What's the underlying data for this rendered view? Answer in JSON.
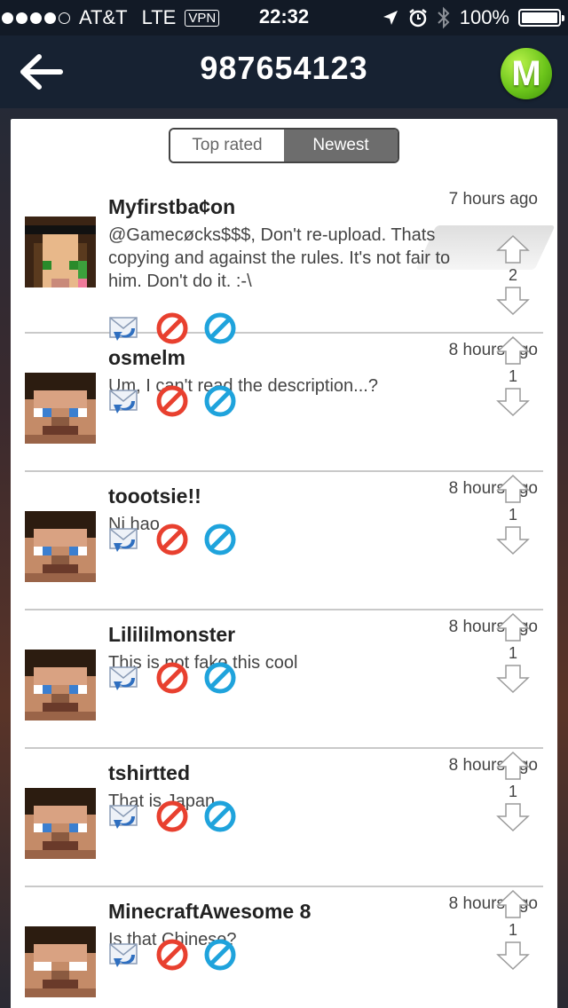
{
  "status_bar": {
    "carrier": "AT&T",
    "network": "LTE",
    "vpn": "VPN",
    "time": "22:32",
    "battery": "100%"
  },
  "nav": {
    "title": "987654123",
    "logo_letter": "M"
  },
  "tabs": [
    {
      "label": "Top rated",
      "active": false
    },
    {
      "label": "Newest",
      "active": true
    }
  ],
  "comments": [
    {
      "user": "Myfirstba¢on",
      "time": "7 hours ago",
      "text": "@Gamecøcks$$$, Don't re-upload. Thats copying and against the rules. It's not fair to him. Don't do it. :-\\",
      "votes": "2",
      "avatar": "girl"
    },
    {
      "user": "osmelm",
      "time": "8 hours ago",
      "text": "Um, I can't read the description...?",
      "votes": "1",
      "avatar": "steve"
    },
    {
      "user": "toootsie!!",
      "time": "8 hours ago",
      "text": "Ni hao",
      "votes": "1",
      "avatar": "steve"
    },
    {
      "user": "Lilililmonster",
      "time": "8 hours ago",
      "text": "This is not fake this cool",
      "votes": "1",
      "avatar": "steve"
    },
    {
      "user": "tshirtted",
      "time": "8 hours ago",
      "text": "That is Japan",
      "votes": "1",
      "avatar": "steve"
    },
    {
      "user": "MinecraftAwesome 8",
      "time": "8 hours ago",
      "text": "Is that Chinese?",
      "votes": "1",
      "avatar": "herobrine"
    }
  ],
  "colors": {
    "status_bar_bg": "#121a26",
    "nav_bg": "#172232",
    "logo_green": "#6cc51b",
    "report_red": "#e8402f",
    "block_blue": "#1fa3dc",
    "active_tab": "#6d6d6d"
  },
  "icons": {
    "back": "arrow-left-icon",
    "reply": "reply-mail-icon",
    "report": "report-icon",
    "block": "block-icon",
    "upvote": "arrow-up-icon",
    "downvote": "arrow-down-icon"
  }
}
